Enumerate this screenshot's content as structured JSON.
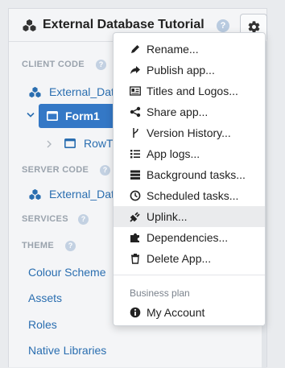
{
  "header": {
    "title": "External Database Tutorial",
    "help_icon": "question-circle-icon",
    "settings_icon": "gear-icon"
  },
  "sidebar": {
    "client_code": {
      "heading": "CLIENT CODE",
      "items": [
        {
          "label": "External_Dat",
          "icon": "cubes-icon"
        },
        {
          "label": "Form1",
          "icon": "form-icon",
          "selected": true,
          "expanded": true
        },
        {
          "label": "RowT",
          "icon": "form-icon"
        }
      ]
    },
    "server_code": {
      "heading": "SERVER CODE",
      "items": [
        {
          "label": "External_Dat",
          "icon": "cubes-icon"
        }
      ]
    },
    "services": {
      "heading": "SERVICES"
    },
    "theme": {
      "heading": "THEME",
      "items": [
        "Colour Scheme",
        "Assets",
        "Roles",
        "Native Libraries"
      ]
    }
  },
  "menu": {
    "items": [
      {
        "label": "Rename...",
        "icon": "pencil-icon"
      },
      {
        "label": "Publish app...",
        "icon": "share-arrow-icon"
      },
      {
        "label": "Titles and Logos...",
        "icon": "id-card-icon"
      },
      {
        "label": "Share app...",
        "icon": "share-nodes-icon"
      },
      {
        "label": "Version History...",
        "icon": "code-fork-icon"
      },
      {
        "label": "App logs...",
        "icon": "list-icon"
      },
      {
        "label": "Background tasks...",
        "icon": "tasks-icon"
      },
      {
        "label": "Scheduled tasks...",
        "icon": "clock-icon"
      },
      {
        "label": "Uplink...",
        "icon": "plug-icon",
        "highlighted": true
      },
      {
        "label": "Dependencies...",
        "icon": "puzzle-icon"
      },
      {
        "label": "Delete App...",
        "icon": "trash-icon"
      }
    ],
    "section_label": "Business plan",
    "account_item": {
      "label": "My Account",
      "icon": "info-circle-icon"
    }
  },
  "colors": {
    "accent": "#3478c6",
    "link": "#2a6eb0",
    "section_heading": "#9aa3ad",
    "help_icon": "#b9cbe0"
  }
}
